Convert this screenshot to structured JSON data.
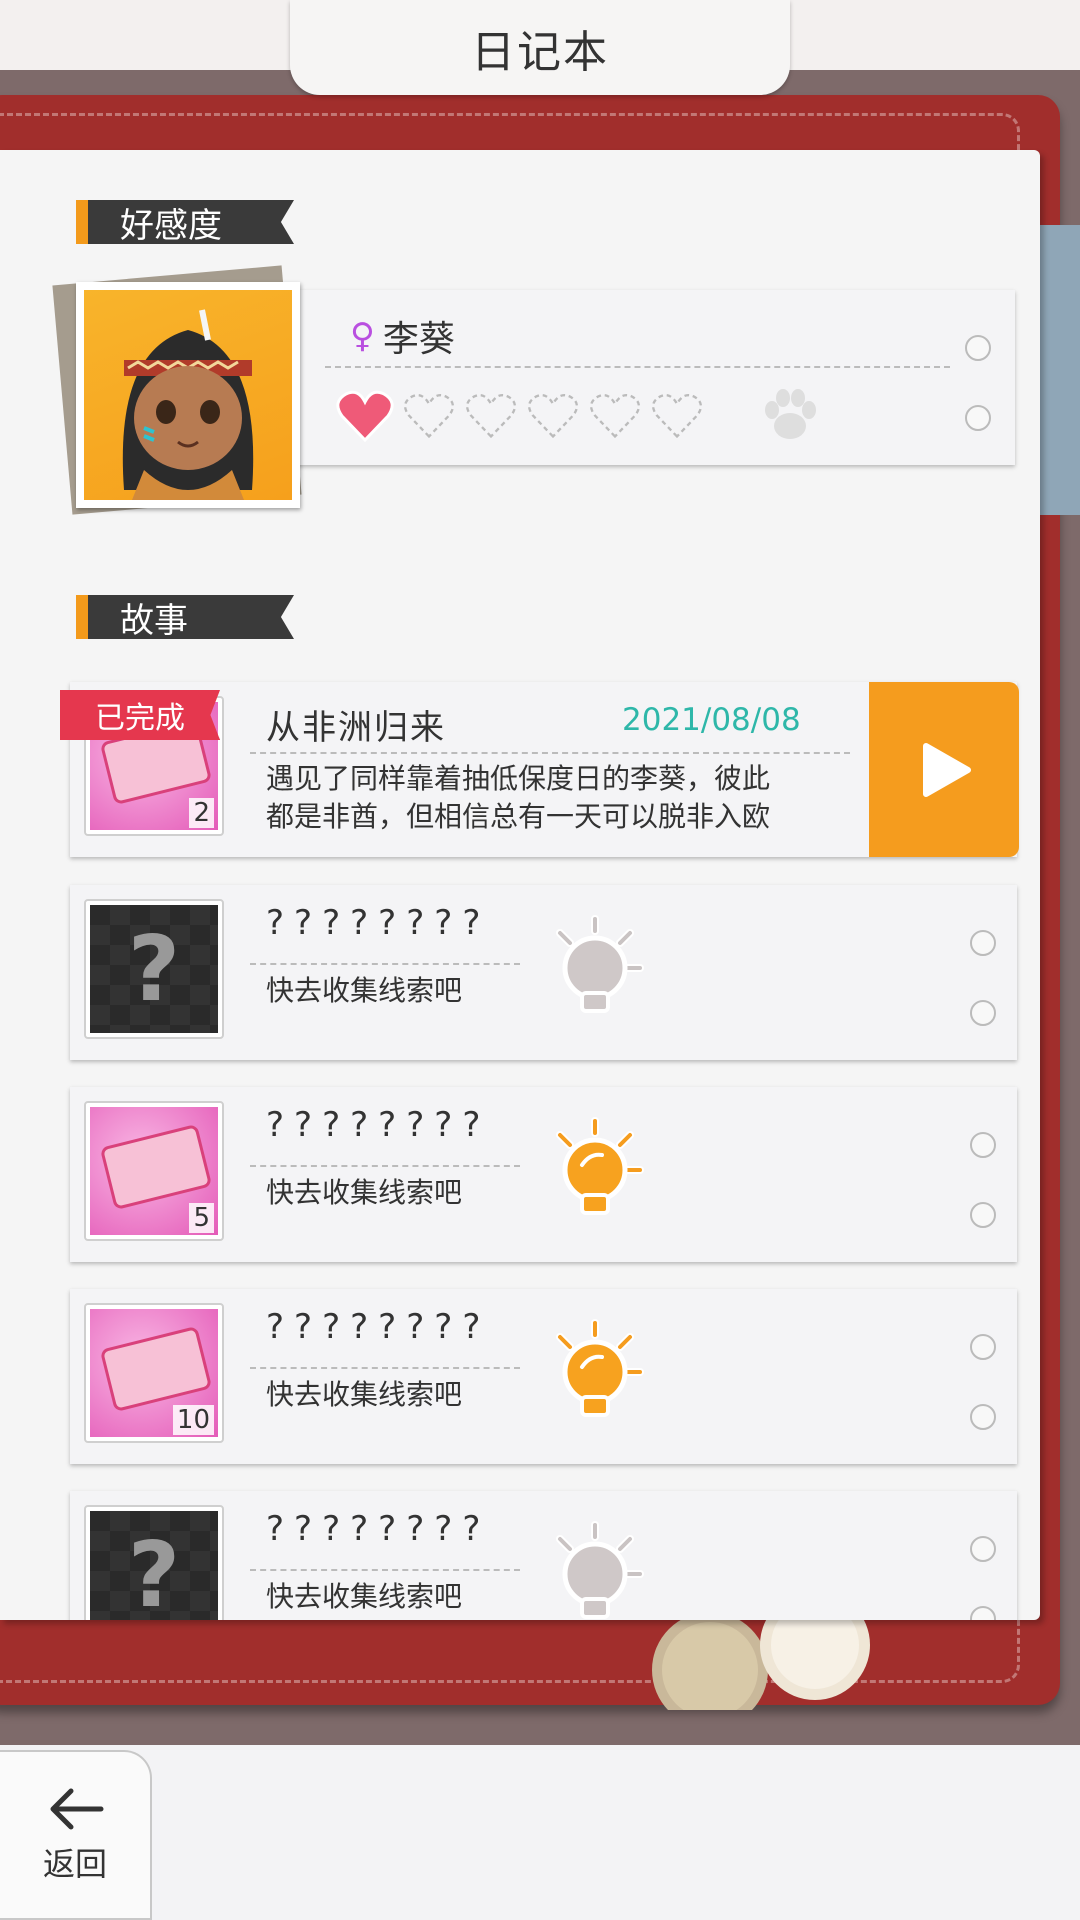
{
  "header": {
    "title": "日记本"
  },
  "affection": {
    "section_label": "好感度",
    "character_name": "李葵",
    "hearts_filled": 1,
    "hearts_total": 6
  },
  "story": {
    "section_label": "故事",
    "completed_label": "已完成",
    "items": [
      {
        "title": "从非洲归来",
        "date": "2021/08/08",
        "description_line1": "遇见了同样靠着抽低保度日的李葵，彼此",
        "description_line2": "都是非酋，但相信总有一天可以脱非入欧",
        "count": "2",
        "completed": true
      },
      {
        "title": "????????",
        "hint": "快去收集线索吧",
        "locked": true,
        "bulb": "gray"
      },
      {
        "title": "????????",
        "hint": "快去收集线索吧",
        "count": "5",
        "bulb": "orange"
      },
      {
        "title": "????????",
        "hint": "快去收集线索吧",
        "count": "10",
        "bulb": "orange"
      },
      {
        "title": "????????",
        "hint": "快去收集线索吧",
        "locked": true,
        "bulb": "gray"
      }
    ]
  },
  "footer": {
    "back_label": "返回"
  },
  "colors": {
    "accent_orange": "#f59c1e",
    "date_teal": "#2eb7a9",
    "ribbon_red": "#e5374e",
    "cover_red": "#a12e2c"
  }
}
